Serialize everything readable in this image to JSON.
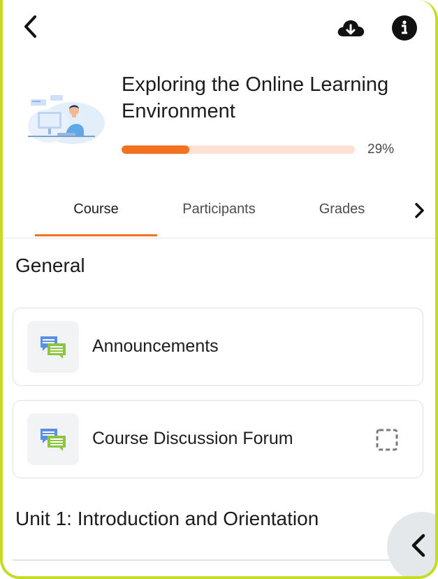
{
  "header": {
    "back_icon": "chevron-left-icon",
    "download_icon": "cloud-download-icon",
    "info_icon": "info-circle-icon"
  },
  "course": {
    "title": "Exploring the Online Learning Environment",
    "progress_percent": 29,
    "progress_label": "29%",
    "image": "course-illustration-person-at-computer"
  },
  "tabs": [
    {
      "label": "Course",
      "active": true
    },
    {
      "label": "Participants",
      "active": false
    },
    {
      "label": "Grades",
      "active": false
    }
  ],
  "sections": [
    {
      "title": "General",
      "items": [
        {
          "label": "Announcements",
          "icon": "forum-chat-icon"
        },
        {
          "label": "Course Discussion Forum",
          "icon": "forum-chat-icon",
          "completion": "manual-completion-checkbox"
        }
      ]
    },
    {
      "title": "Unit 1: Introduction and Orientation",
      "items": []
    }
  ],
  "colors": {
    "accent": "#f2721f",
    "progress_track": "#fde1d2",
    "frame_border": "#c5dc27",
    "forum_blue": "#5b8ee6",
    "forum_green": "#8cc63f"
  }
}
